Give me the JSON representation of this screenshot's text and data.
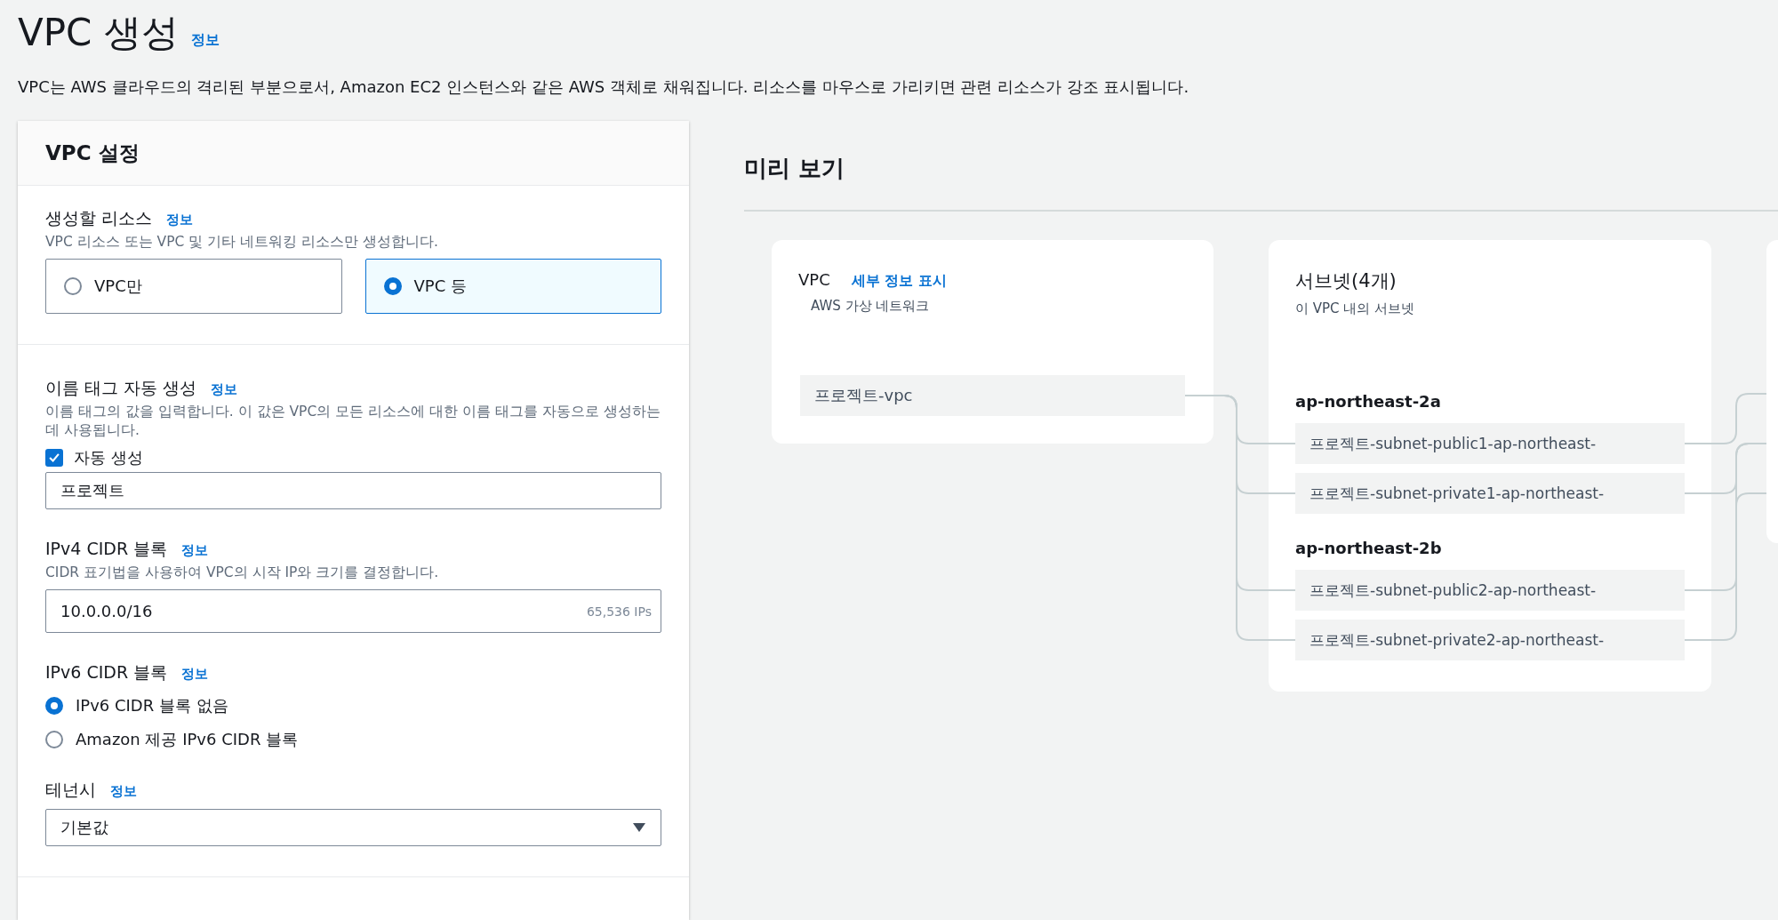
{
  "page": {
    "title": "VPC 생성",
    "info_link": "정보",
    "description": "VPC는 AWS 클라우드의 격리된 부분으로서, Amazon EC2 인스턴스와 같은 AWS 객체로 채워집니다. 리소스를 마우스로 가리키면 관련 리소스가 강조 표시됩니다."
  },
  "settings_panel": {
    "title": "VPC 설정",
    "groups": [
      {
        "fields": [
          {
            "kind": "tiles",
            "label": "생성할 리소스",
            "info": "정보",
            "description": "VPC 리소스 또는 VPC 및 기타 네트워킹 리소스만 생성합니다.",
            "options": [
              {
                "label": "VPC만",
                "selected": false
              },
              {
                "label": "VPC 등",
                "selected": true
              }
            ]
          }
        ]
      },
      {
        "fields": [
          {
            "kind": "name_tag",
            "label": "이름 태그 자동 생성",
            "info": "정보",
            "description": "이름 태그의 값을 입력합니다. 이 값은 VPC의 모든 리소스에 대한 이름 태그를 자동으로 생성하는 데 사용됩니다.",
            "checkbox": {
              "label": "자동 생성",
              "checked": true
            },
            "value": "프로젝트"
          },
          {
            "kind": "cidr",
            "label": "IPv4 CIDR 블록",
            "info": "정보",
            "description": "CIDR 표기법을 사용하여 VPC의 시작 IP와 크기를 결정합니다.",
            "value": "10.0.0.0/16",
            "hint": "65,536 IPs"
          },
          {
            "kind": "radio",
            "label": "IPv6 CIDR 블록",
            "info": "정보",
            "options": [
              {
                "label": "IPv6 CIDR 블록 없음",
                "selected": true
              },
              {
                "label": "Amazon 제공 IPv6 CIDR 블록",
                "selected": false
              }
            ]
          },
          {
            "kind": "select",
            "label": "테넌시",
            "info": "정보",
            "value": "기본값"
          }
        ]
      }
    ]
  },
  "preview": {
    "title": "미리 보기",
    "vpc_card": {
      "title": "VPC",
      "link": "세부 정보 표시",
      "subtitle": "AWS 가상 네트워크",
      "resource": "프로젝트-vpc"
    },
    "subnet_card": {
      "title": "서브넷(4개)",
      "subtitle": "이 VPC 내의 서브넷",
      "zones": [
        {
          "name": "ap-northeast-2a",
          "subnets": [
            "프로젝트-subnet-public1-ap-northeast-",
            "프로젝트-subnet-private1-ap-northeast-"
          ]
        },
        {
          "name": "ap-northeast-2b",
          "subnets": [
            "프로젝트-subnet-public2-ap-northeast-",
            "프로젝트-subnet-private2-ap-northeast-"
          ]
        }
      ]
    }
  }
}
